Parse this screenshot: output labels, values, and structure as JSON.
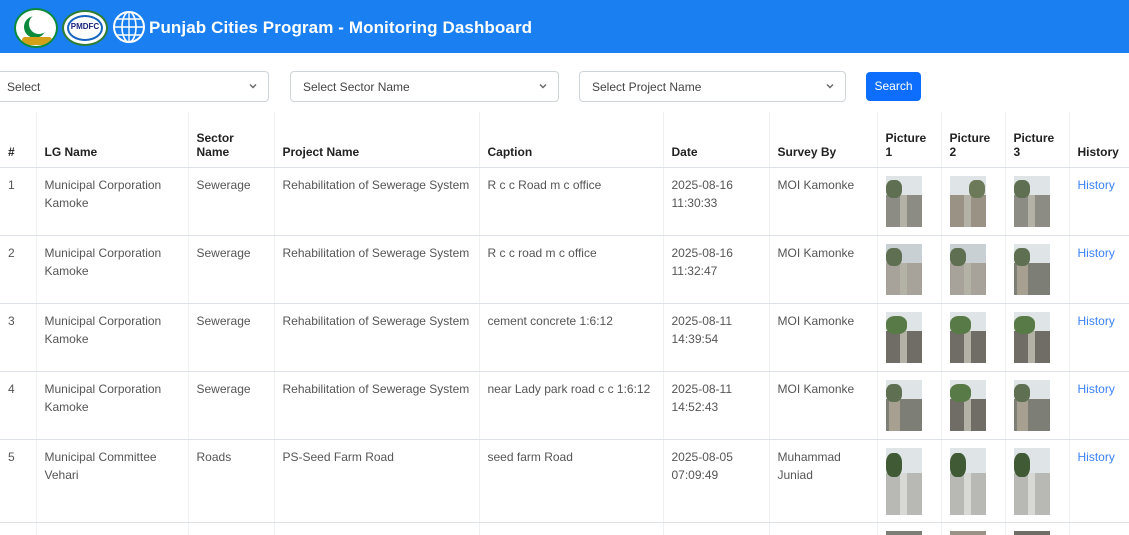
{
  "header": {
    "title": "Punjab Cities Program - Monitoring Dashboard",
    "logo2_text": "PMDFC"
  },
  "filters": {
    "lg_select": "Select",
    "sector_select": "Select Sector Name",
    "project_select": "Select Project Name",
    "search_label": "Search"
  },
  "table": {
    "headers": {
      "num": "#",
      "lg_name": "LG Name",
      "sector": "Sector Name",
      "project": "Project Name",
      "caption": "Caption",
      "date": "Date",
      "survey_by": "Survey By",
      "pic1": "Picture 1",
      "pic2": "Picture 2",
      "pic3": "Picture 3",
      "history": "History"
    },
    "rows": [
      {
        "num": "1",
        "lg": "Municipal Corporation Kamoke",
        "sector": "Sewerage",
        "project": "Rehabilitation of Sewerage System",
        "caption": "R c c Road m c office",
        "date": "2025-08-16 11:30:33",
        "survey_by": "MOI Kamonke",
        "history": "History"
      },
      {
        "num": "2",
        "lg": "Municipal Corporation Kamoke",
        "sector": "Sewerage",
        "project": "Rehabilitation of Sewerage System",
        "caption": "R c c road m c office",
        "date": "2025-08-16 11:32:47",
        "survey_by": "MOI Kamonke",
        "history": "History"
      },
      {
        "num": "3",
        "lg": "Municipal Corporation Kamoke",
        "sector": "Sewerage",
        "project": "Rehabilitation of Sewerage System",
        "caption": "cement concrete 1:6:12",
        "date": "2025-08-11 14:39:54",
        "survey_by": "MOI Kamonke",
        "history": "History"
      },
      {
        "num": "4",
        "lg": "Municipal Corporation Kamoke",
        "sector": "Sewerage",
        "project": "Rehabilitation of Sewerage System",
        "caption": "near Lady park road c c 1:6:12",
        "date": "2025-08-11 14:52:43",
        "survey_by": "MOI Kamonke",
        "history": "History"
      },
      {
        "num": "5",
        "lg": "Municipal Committee Vehari",
        "sector": "Roads",
        "project": "PS-Seed Farm Road",
        "caption": "seed farm Road",
        "date": "2025-08-05 07:09:49",
        "survey_by": "Muhammad Juniad",
        "history": "History"
      }
    ]
  },
  "colors": {
    "header_bg": "#1a7ff0",
    "button_bg": "#0d6efd",
    "link": "#3b82f6"
  }
}
